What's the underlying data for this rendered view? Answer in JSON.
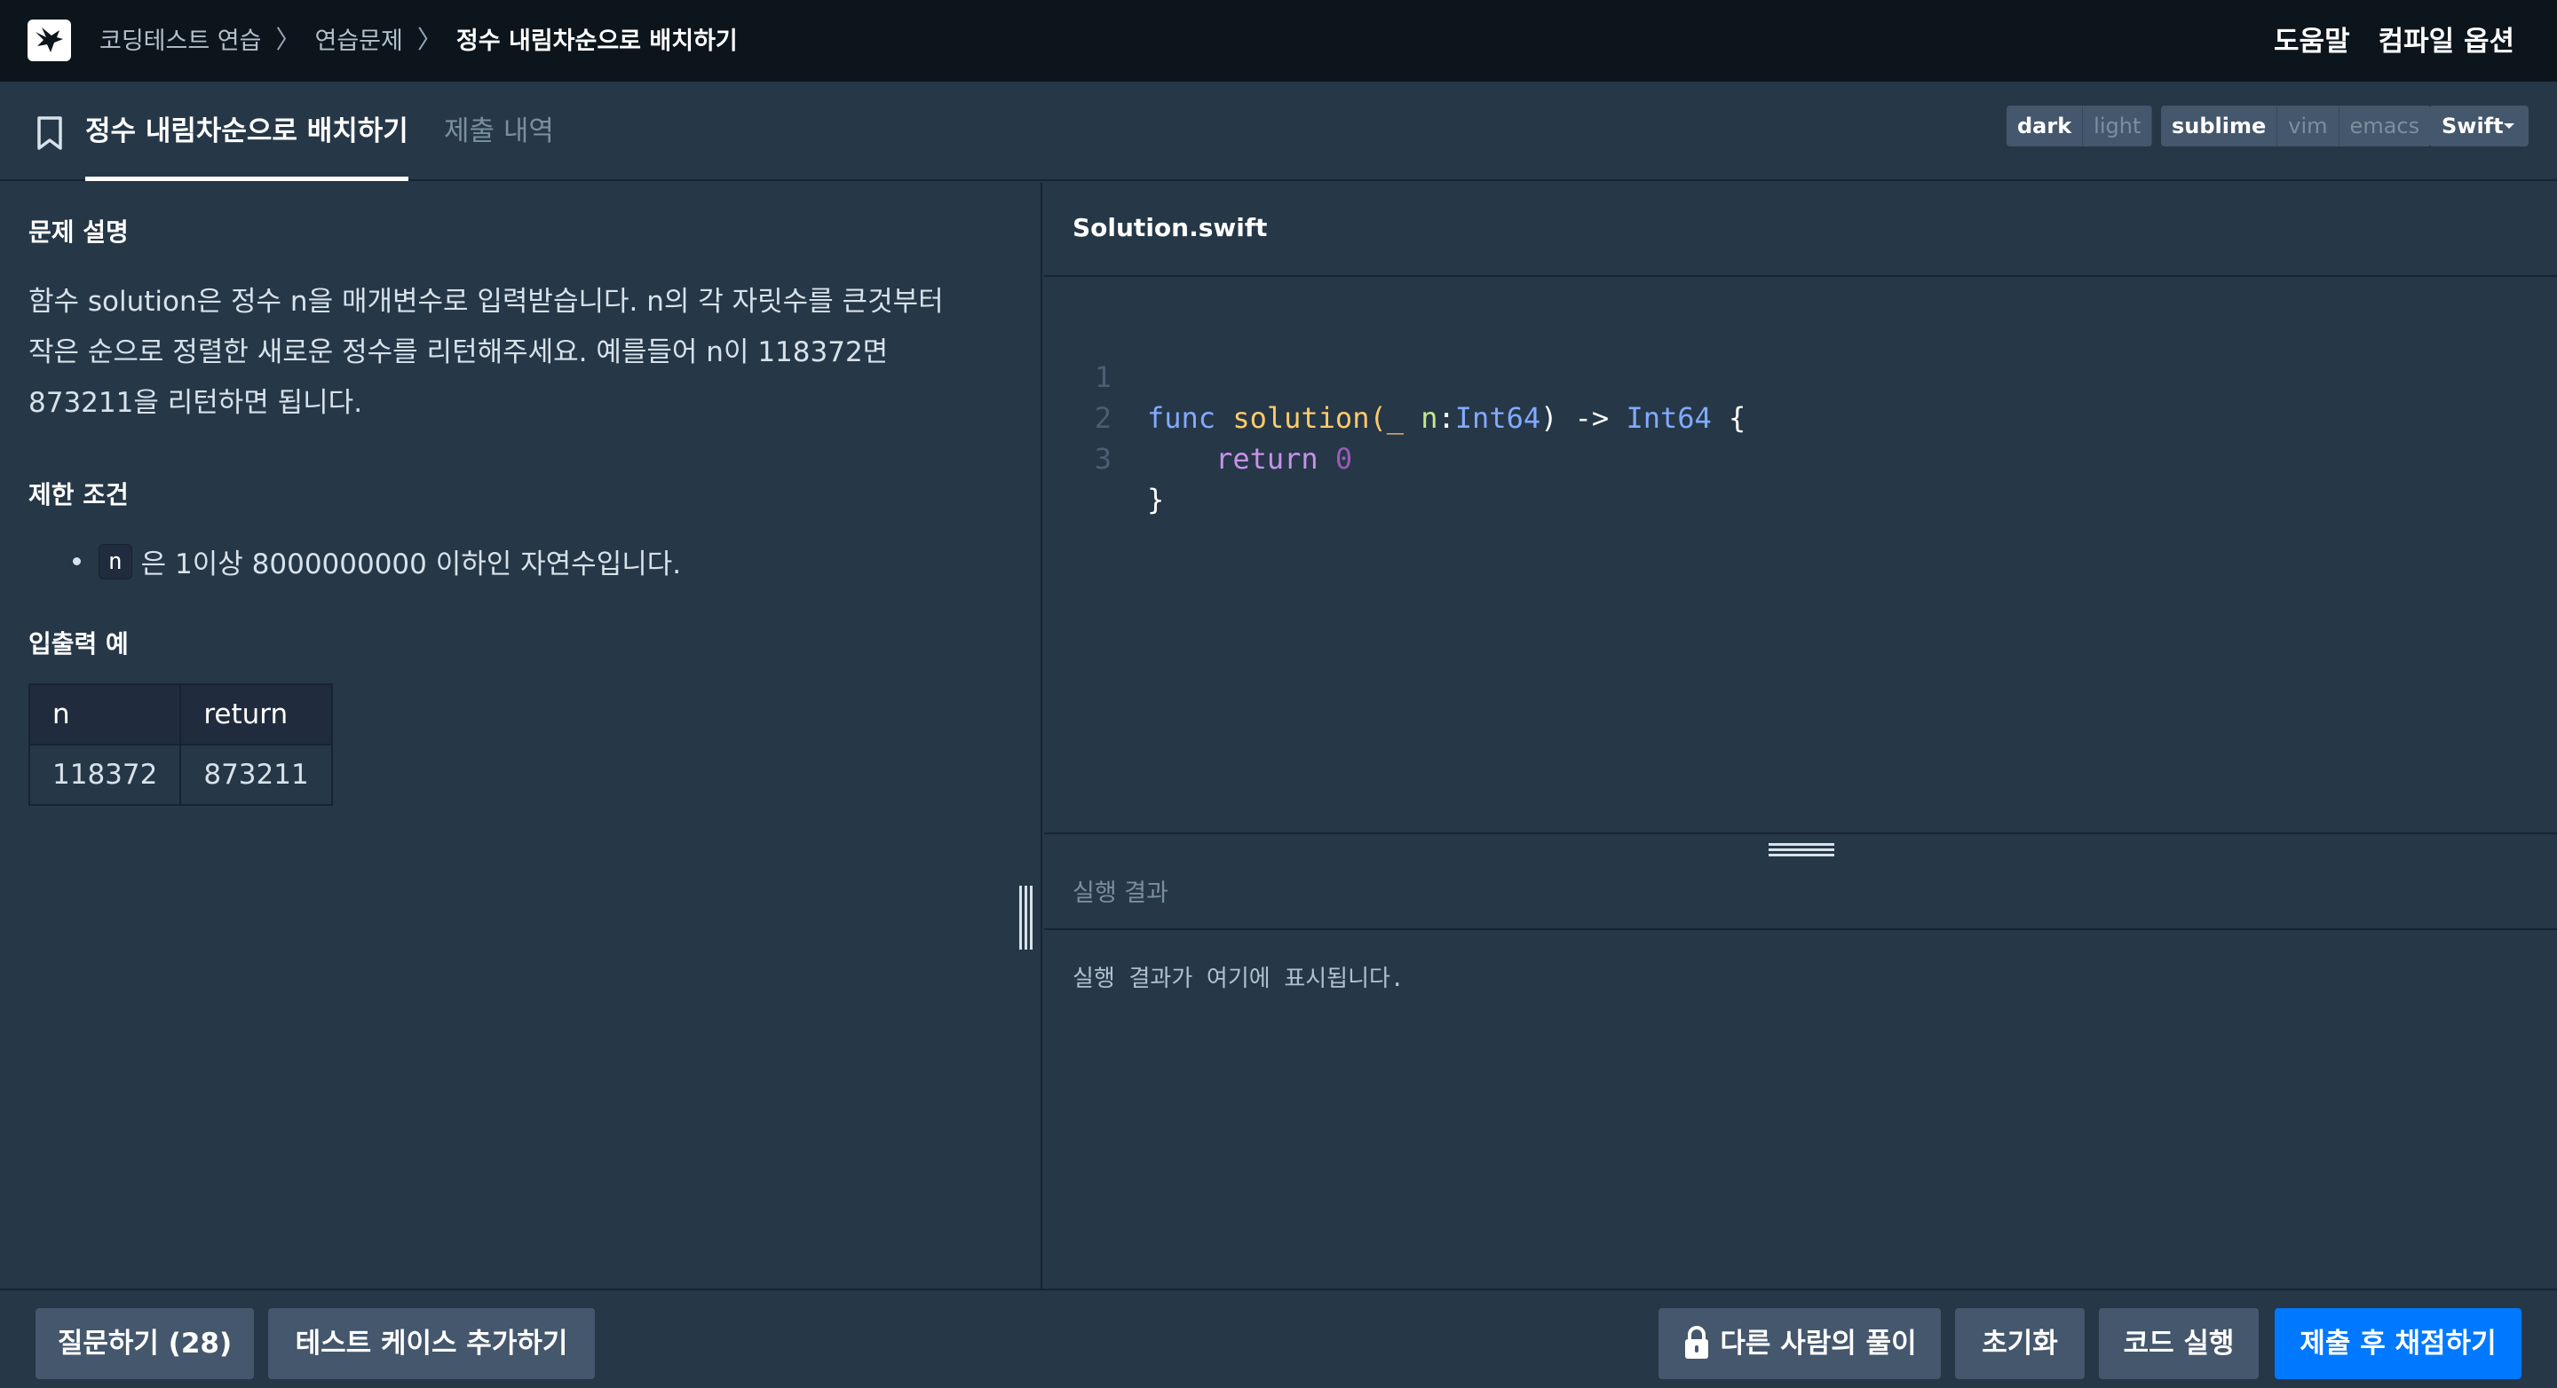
{
  "header": {
    "breadcrumb": [
      "코딩테스트 연습",
      "연습문제",
      "정수 내림차순으로 배치하기"
    ],
    "breadcrumb_separator": "〉",
    "help_label": "도움말",
    "compile_options_label": "컴파일 옵션"
  },
  "tabs": {
    "active": "정수 내림차순으로 배치하기",
    "submissions": "제출 내역"
  },
  "theme_toggle": {
    "dark": "dark",
    "light": "light",
    "selected": "dark"
  },
  "keymap_toggle": {
    "sublime": "sublime",
    "vim": "vim",
    "emacs": "emacs",
    "selected": "sublime"
  },
  "language_select": {
    "value": "Swift"
  },
  "problem": {
    "description_heading": "문제 설명",
    "description_lines": [
      "함수 solution은 정수 n을 매개변수로 입력받습니다. n의 각 자릿수를 큰것부터",
      "작은 순으로 정렬한 새로운 정수를 리턴해주세요. 예를들어 n이 118372면",
      "873211을 리턴하면 됩니다."
    ],
    "constraints_heading": "제한 조건",
    "constraint_code": "n",
    "constraint_text": "은 1이상 8000000000 이하인 자연수입니다.",
    "io_heading": "입출력 예",
    "io_table": {
      "headers": [
        "n",
        "return"
      ],
      "rows": [
        [
          "118372",
          "873211"
        ]
      ]
    }
  },
  "editor": {
    "file_name": "Solution.swift",
    "line_numbers": [
      "1",
      "2",
      "3"
    ],
    "code": {
      "l1_func": "func",
      "l1_name": "solution",
      "l1_open": "(",
      "l1_underscore": "_",
      "l1_param": "n",
      "l1_colon": ":",
      "l1_type": "Int64",
      "l1_close": ")",
      "l1_arrow": "->",
      "l1_ret_type": "Int64",
      "l1_brace": "{",
      "l2_return": "return",
      "l2_value": "0",
      "l3_brace": "}"
    }
  },
  "result": {
    "title": "실행 결과",
    "placeholder": "실행 결과가 여기에 표시됩니다."
  },
  "footer": {
    "ask_label": "질문하기 (28)",
    "add_testcase_label": "테스트 케이스 추가하기",
    "others_solution_label": "다른 사람의 풀이",
    "reset_label": "초기화",
    "run_label": "코드 실행",
    "submit_label": "제출 후 채점하기"
  },
  "colors": {
    "topbar": "#0c151c",
    "panel": "#263747",
    "button": "#44576c",
    "primary": "#0078ff",
    "keyword": "#c792ea",
    "function": "#ffcb6b",
    "type": "#82aaff"
  }
}
